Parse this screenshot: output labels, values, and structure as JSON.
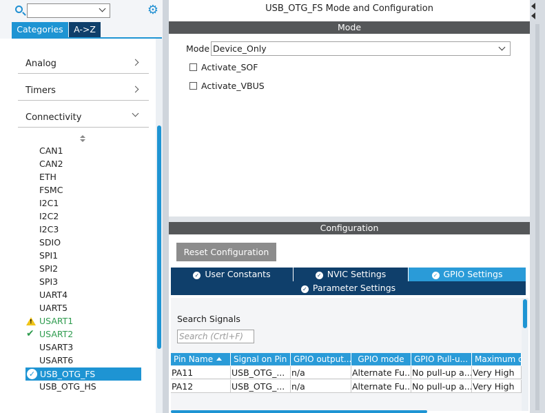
{
  "left": {
    "search_value": "",
    "tabs": {
      "categories": "Categories",
      "az": "A->Z"
    },
    "categories": [
      {
        "label": "Analog"
      },
      {
        "label": "Timers"
      },
      {
        "label": "Connectivity"
      }
    ],
    "peripherals": [
      "CAN1",
      "CAN2",
      "ETH",
      "FSMC",
      "I2C1",
      "I2C2",
      "I2C3",
      "SDIO",
      "SPI1",
      "SPI2",
      "SPI3",
      "UART4",
      "UART5",
      "USART1",
      "USART2",
      "USART3",
      "USART6",
      "USB_OTG_FS",
      "USB_OTG_HS"
    ],
    "peripheral_states": {
      "USART1": "warning",
      "USART2": "configured",
      "USB_OTG_FS": "selected"
    }
  },
  "mode_panel": {
    "title": "USB_OTG_FS Mode and Configuration",
    "section": "Mode",
    "mode_label": "Mode",
    "mode_value": "Device_Only",
    "checkboxes": [
      {
        "label": "Activate_SOF",
        "checked": false
      },
      {
        "label": "Activate_VBUS",
        "checked": false
      }
    ]
  },
  "config_panel": {
    "section": "Configuration",
    "reset_label": "Reset Configuration",
    "tabs": [
      {
        "label": "User Constants",
        "active": false
      },
      {
        "label": "NVIC Settings",
        "active": false
      },
      {
        "label": "GPIO Settings",
        "active": true
      },
      {
        "label": "Parameter Settings",
        "active": false
      }
    ],
    "search_label": "Search Signals",
    "search_placeholder": "Search (Crtl+F)",
    "columns": [
      "Pin Name",
      "Signal on Pin",
      "GPIO output...",
      "GPIO mode",
      "GPIO Pull-u...",
      "Maximum o..."
    ],
    "rows": [
      [
        "PA11",
        "USB_OTG_...",
        "n/a",
        "Alternate Fu...",
        "No pull-up a...",
        "Very High"
      ],
      [
        "PA12",
        "USB_OTG_...",
        "n/a",
        "Alternate Fu...",
        "No pull-up a...",
        "Very High"
      ]
    ]
  },
  "colors": {
    "accent": "#1e94d3",
    "tab_dark": "#0f3f6b",
    "section_bar": "#555759",
    "ok_green": "#2e9b4e",
    "warning": "#f0c419"
  }
}
